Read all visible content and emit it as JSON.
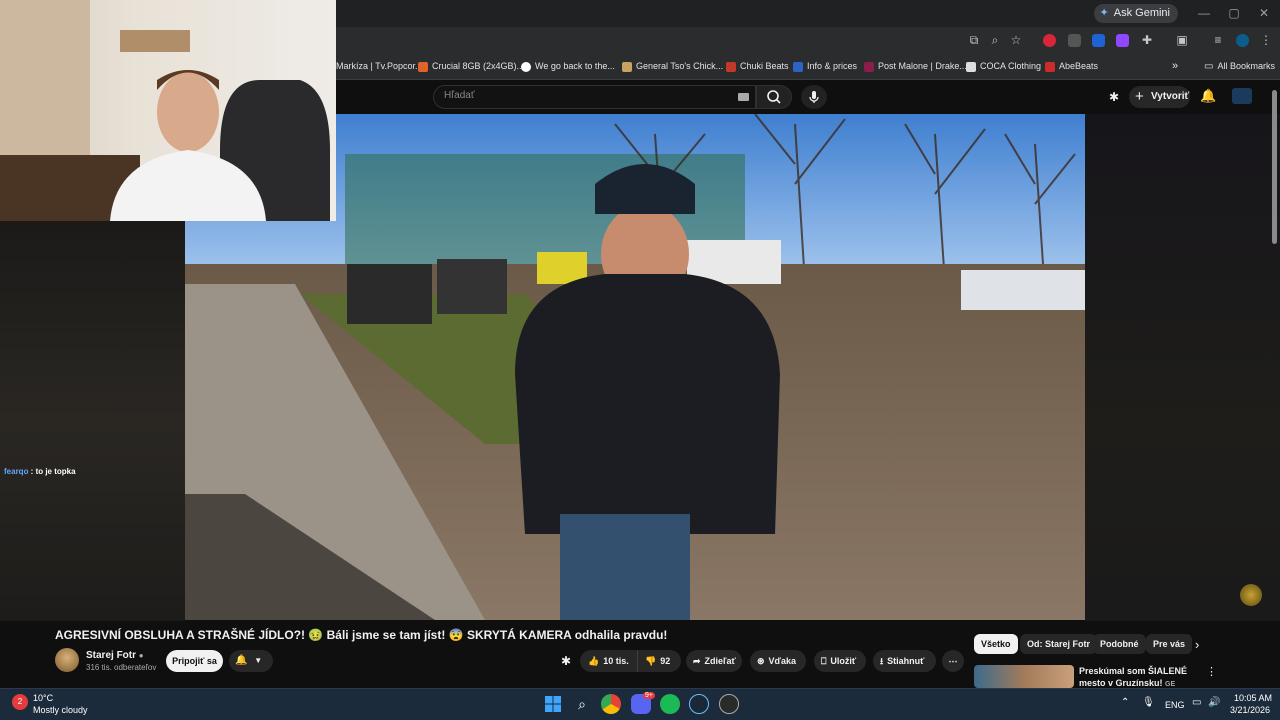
{
  "browser": {
    "ask_gemini": "Ask Gemini",
    "bookmarks": [
      {
        "label": "Markíza | Tv.Popcor...",
        "color": "#a33f2a"
      },
      {
        "label": "Crucial 8GB (2x4GB)...",
        "color": "#e0632b"
      },
      {
        "label": "We go back to the...",
        "color": "#ffffff"
      },
      {
        "label": "General Tso's Chick...",
        "color": "#c9a35d"
      },
      {
        "label": "Chuki Beats",
        "color": "#c0392b"
      },
      {
        "label": "Info & prices",
        "color": "#2d62c8"
      },
      {
        "label": "Post Malone | Drake...",
        "color": "#8b1d4a"
      },
      {
        "label": "COCA Clothing",
        "color": "#dddddd"
      },
      {
        "label": "AbeBeats",
        "color": "#cc2b2b"
      }
    ],
    "all_bookmarks": "All Bookmarks"
  },
  "youtube": {
    "search_placeholder": "Hľadať",
    "create_label": "Vytvoriť",
    "video": {
      "title": "AGRESIVNÍ OBSLUHA A STRAŠNÉ JÍDLO?! 🤢 Báli jsme se tam jíst! 😨 SKRYTÁ KAMERA odhalila pravdu!",
      "channel": "Starej Fotr",
      "subscribers": "316 tis. odberateľov",
      "join_label": "Pripojiť sa",
      "likes": "10 tis.",
      "dislikes": "92",
      "share_label": "Zdieľať",
      "thanks_label": "Vďaka",
      "save_label": "Uložiť",
      "download_label": "Stiahnuť"
    },
    "chips": [
      "Všetko",
      "Od: Starej Fotr",
      "Podobné",
      "Pre vás"
    ],
    "recommendation": {
      "title": "Preskúmal som ŠIALENÉ mesto v Gruzínsku!",
      "suffix": "GE"
    }
  },
  "chat": {
    "user": "fearqo",
    "message": " : to je topka"
  },
  "taskbar": {
    "weather_temp": "10°C",
    "weather_desc": "Mostly cloudy",
    "weather_badge": "2",
    "discord_badge": "9+",
    "language": "ENG",
    "time": "10:05 AM",
    "date": "3/21/2026"
  }
}
